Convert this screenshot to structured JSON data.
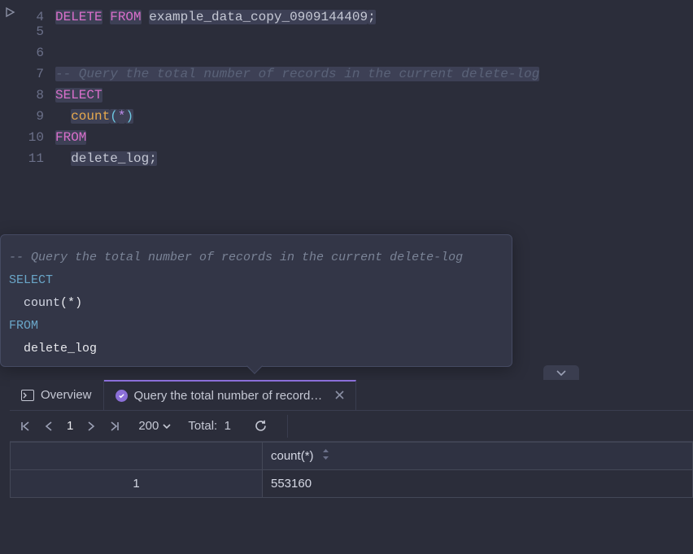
{
  "editor": {
    "startLine": 4,
    "lines": [
      {
        "n": 4,
        "run": true,
        "tokens": [
          {
            "t": "DELETE",
            "c": "kw-purple hl"
          },
          {
            "t": " ",
            "c": ""
          },
          {
            "t": "FROM",
            "c": "kw-purple hl"
          },
          {
            "t": " ",
            "c": ""
          },
          {
            "t": "example_data_copy_0909144409",
            "c": "ident hl"
          },
          {
            "t": ";",
            "c": "semic hl"
          }
        ]
      },
      {
        "n": 5,
        "run": false,
        "tokens": []
      },
      {
        "n": 6,
        "run": false,
        "tokens": []
      },
      {
        "n": 7,
        "run": false,
        "tokens": [
          {
            "t": "-- Query the total number of records in the current delete-log",
            "c": "comment hl"
          }
        ]
      },
      {
        "n": 8,
        "run": false,
        "tokens": [
          {
            "t": "SELECT",
            "c": "kw-purple hl"
          }
        ]
      },
      {
        "n": 9,
        "run": false,
        "tokens": [
          {
            "t": "  ",
            "c": ""
          },
          {
            "t": "count",
            "c": "kw-orange hl"
          },
          {
            "t": "(",
            "c": "paren-cyan hl"
          },
          {
            "t": "*",
            "c": "star-purple hl"
          },
          {
            "t": ")",
            "c": "paren-cyan hl"
          }
        ]
      },
      {
        "n": 10,
        "run": false,
        "tokens": [
          {
            "t": "FROM",
            "c": "kw-purple hl"
          }
        ]
      },
      {
        "n": 11,
        "run": false,
        "tokens": [
          {
            "t": "  ",
            "c": ""
          },
          {
            "t": "delete_log",
            "c": "ident hl"
          },
          {
            "t": ";",
            "c": "semic hl"
          }
        ]
      }
    ]
  },
  "tooltip": {
    "lines": [
      [
        {
          "t": "-- Query the total number of records in the current delete-log",
          "c": "tt-comment"
        }
      ],
      [
        {
          "t": "SELECT",
          "c": "tt-kw"
        }
      ],
      [
        {
          "t": "  ",
          "c": ""
        },
        {
          "t": "count",
          "c": "tt-plain"
        },
        {
          "t": "(",
          "c": "tt-white"
        },
        {
          "t": "*",
          "c": "tt-white"
        },
        {
          "t": ")",
          "c": "tt-white"
        }
      ],
      [
        {
          "t": "FROM",
          "c": "tt-kw"
        }
      ],
      [
        {
          "t": "  ",
          "c": ""
        },
        {
          "t": "delete_log",
          "c": "tt-white"
        }
      ]
    ]
  },
  "tabs": {
    "overview": "Overview",
    "active_label": "Query the total number of record…"
  },
  "toolbar": {
    "page": "1",
    "page_size": "200",
    "total_label": "Total:",
    "total_value": "1"
  },
  "table": {
    "column_header": "count(*)",
    "rows": [
      {
        "n": "1",
        "v": "553160"
      }
    ]
  }
}
